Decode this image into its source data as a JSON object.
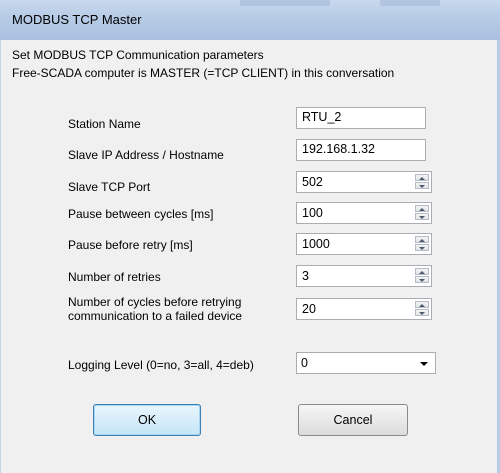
{
  "window": {
    "title": "MODBUS TCP Master"
  },
  "header": {
    "line1": "Set MODBUS TCP Communication parameters",
    "line2": "Free-SCADA computer is MASTER (=TCP CLIENT) in this conversation"
  },
  "fields": {
    "station_name": {
      "label": "Station Name",
      "value": "RTU_2"
    },
    "slave_ip": {
      "label": "Slave IP Address / Hostname",
      "value": "192.168.1.32"
    },
    "slave_port": {
      "label": "Slave TCP Port",
      "value": "502"
    },
    "pause_cycles": {
      "label": "Pause between cycles [ms]",
      "value": "100"
    },
    "pause_retry": {
      "label": "Pause before retry [ms]",
      "value": "1000"
    },
    "num_retries": {
      "label": "Number of retries",
      "value": "3"
    },
    "cycles_before_retry": {
      "label_line1": "Number of cycles before retrying",
      "label_line2": "communication to a failed device",
      "value": "20"
    },
    "logging_level": {
      "label": "Logging Level (0=no,  3=all, 4=deb)",
      "value": "0"
    }
  },
  "buttons": {
    "ok": "OK",
    "cancel": "Cancel"
  }
}
